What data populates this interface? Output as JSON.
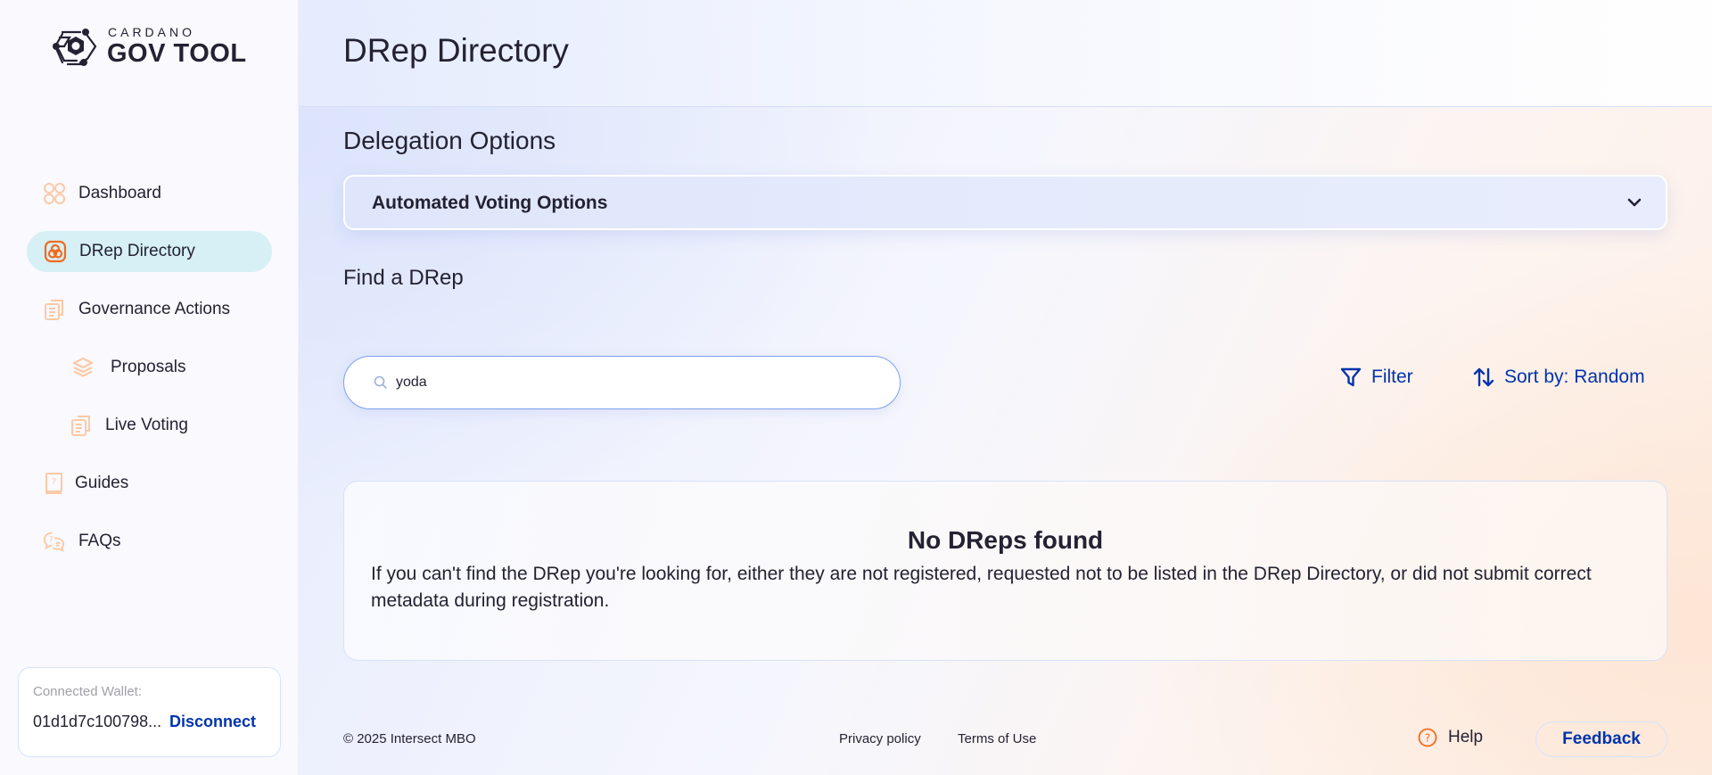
{
  "brand": {
    "small": "CARDANO",
    "big": "GOV TOOL",
    "logo_icon": "hexagon-nut-circuit-icon"
  },
  "sidebar": {
    "items": [
      {
        "label": "Dashboard",
        "icon": "grid-circles-icon",
        "active": false
      },
      {
        "label": "DRep Directory",
        "icon": "drep-circles-icon",
        "active": true
      },
      {
        "label": "Governance Actions",
        "icon": "documents-icon",
        "active": false
      },
      {
        "label": "Proposals",
        "icon": "layers-icon",
        "active": false
      },
      {
        "label": "Live Voting",
        "icon": "documents-icon",
        "active": false
      },
      {
        "label": "Guides",
        "icon": "book-question-icon",
        "active": false
      },
      {
        "label": "FAQs",
        "icon": "chat-question-icon",
        "active": false
      }
    ],
    "wallet": {
      "label": "Connected Wallet:",
      "address": "01d1d7c100798...",
      "disconnect_label": "Disconnect"
    }
  },
  "header": {
    "title": "DRep Directory"
  },
  "delegation": {
    "title": "Delegation Options",
    "accordion_label": "Automated Voting Options",
    "accordion_icon": "chevron-down-icon"
  },
  "find": {
    "title": "Find a DRep",
    "search_value": "yoda",
    "search_icon": "search-icon",
    "filter_label": "Filter",
    "filter_icon": "funnel-icon",
    "sort_label": "Sort by: Random",
    "sort_icon": "sort-arrows-icon"
  },
  "empty_state": {
    "title": "No DReps found",
    "description": "If you can't find the DRep you're looking for, either they are not registered, requested not to be listed in the DRep Directory, or did not submit correct metadata during registration."
  },
  "footer": {
    "copyright": "© 2025 Intersect MBO",
    "privacy": "Privacy policy",
    "terms": "Terms of Use",
    "help": "Help",
    "feedback": "Feedback"
  },
  "colors": {
    "accent_blue": "#0033ad",
    "accent_orange": "#f26b1d",
    "active_nav_bg": "#d6f0f5",
    "text": "#242232"
  }
}
